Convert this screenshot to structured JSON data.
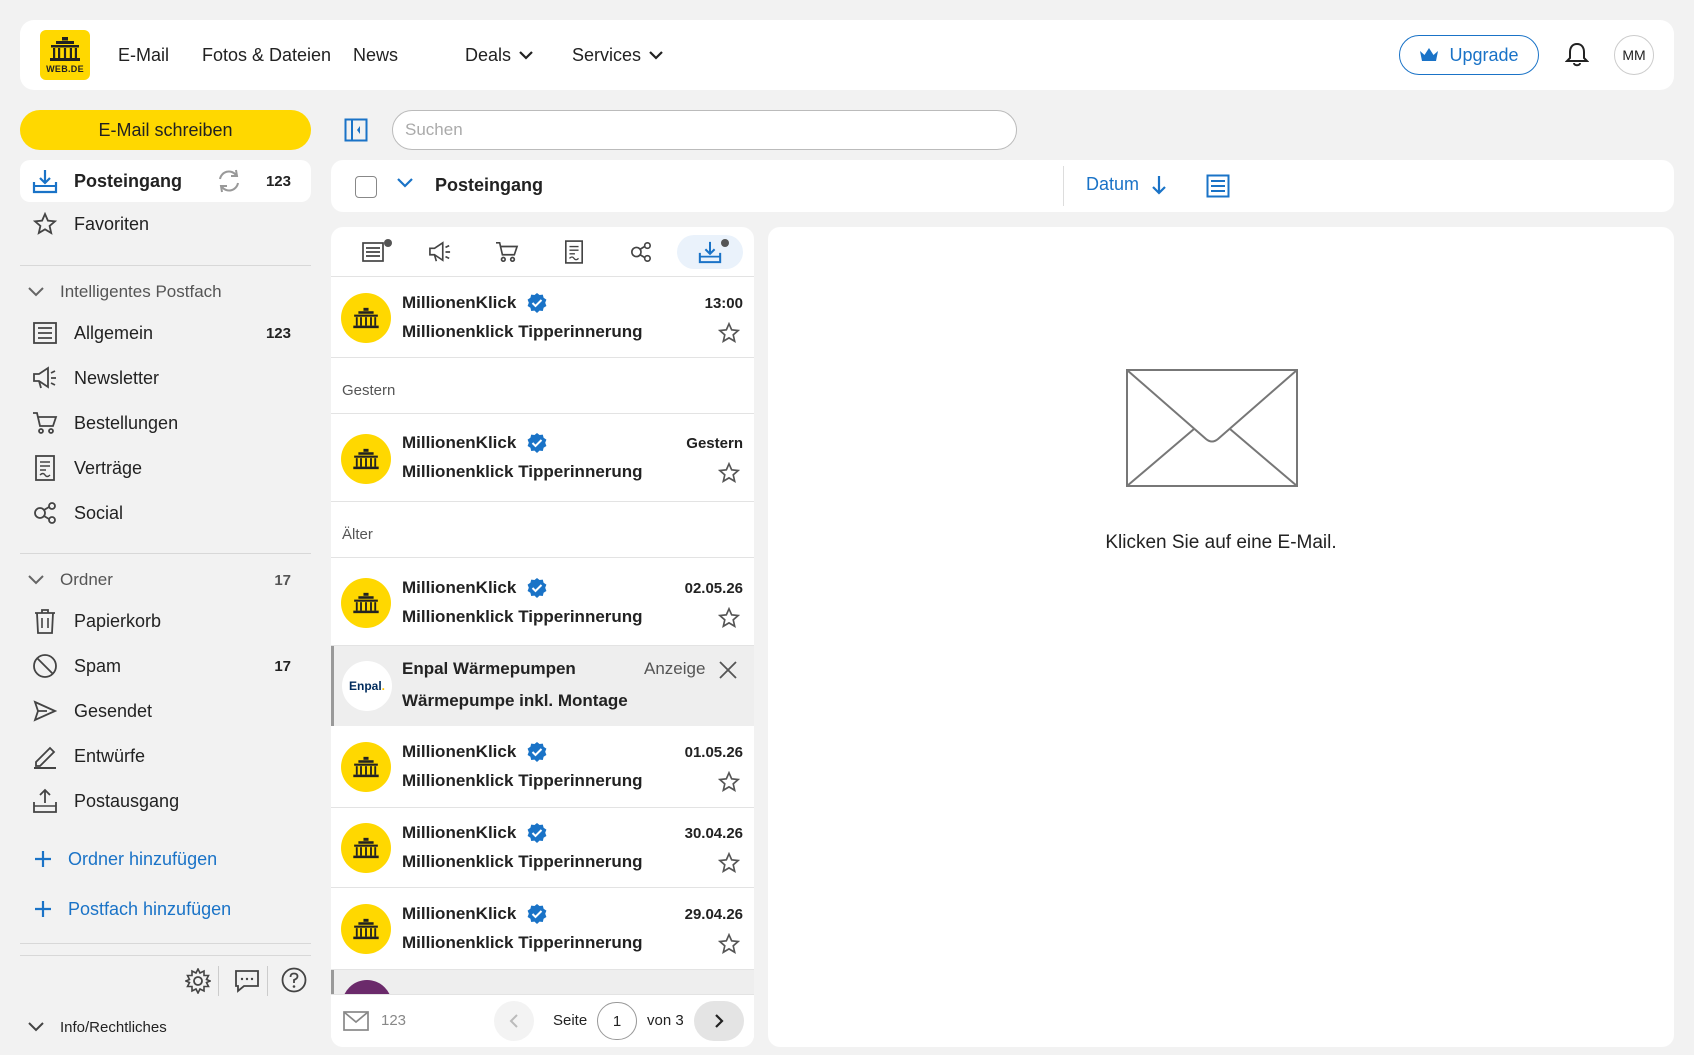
{
  "topnav": {
    "logo_text": "WEB.DE",
    "links": [
      "E-Mail",
      "Fotos & Dateien",
      "News",
      "Deals",
      "Services"
    ],
    "upgrade_label": "Upgrade",
    "avatar_initials": "MM"
  },
  "sidebar": {
    "compose_label": "E-Mail schreiben",
    "inbox": {
      "label": "Posteingang",
      "count": "123"
    },
    "favorites": "Favoriten",
    "smart_section": "Intelligentes Postfach",
    "smart_items": [
      {
        "label": "Allgemein",
        "count": "123"
      },
      {
        "label": "Newsletter",
        "count": ""
      },
      {
        "label": "Bestellungen",
        "count": ""
      },
      {
        "label": "Verträge",
        "count": ""
      },
      {
        "label": "Social",
        "count": ""
      }
    ],
    "folders_section": {
      "label": "Ordner",
      "count": "17"
    },
    "folder_items": [
      {
        "label": "Papierkorb",
        "count": ""
      },
      {
        "label": "Spam",
        "count": "17"
      },
      {
        "label": "Gesendet",
        "count": ""
      },
      {
        "label": "Entwürfe",
        "count": ""
      },
      {
        "label": "Postausgang",
        "count": ""
      }
    ],
    "add_folder": "Ordner hinzufügen",
    "add_mailbox": "Postfach hinzufügen",
    "info_label": "Info/Rechtliches"
  },
  "search": {
    "placeholder": "Suchen"
  },
  "listheader": {
    "title": "Posteingang",
    "sort_label": "Datum"
  },
  "mails": {
    "today": {
      "sender": "MillionenKlick",
      "subject": "Millionenklick Tipperinnerung",
      "date": "13:00"
    },
    "yesterday_label": "Gestern",
    "yesterday": {
      "sender": "MillionenKlick",
      "subject": "Millionenklick Tipperinnerung",
      "date": "Gestern"
    },
    "older_label": "Älter",
    "older": [
      {
        "sender": "MillionenKlick",
        "subject": "Millionenklick Tipperinnerung",
        "date": "02.05.26"
      },
      {
        "sender": "MillionenKlick",
        "subject": "Millionenklick Tipperinnerung",
        "date": "01.05.26"
      },
      {
        "sender": "MillionenKlick",
        "subject": "Millionenklick Tipperinnerung",
        "date": "30.04.26"
      },
      {
        "sender": "MillionenKlick",
        "subject": "Millionenklick Tipperinnerung",
        "date": "29.04.26"
      }
    ],
    "ad": {
      "sender": "Enpal Wärmepumpen",
      "subject": "Wärmepumpe inkl. Montage",
      "tag": "Anzeige",
      "logo_text": "Enpal"
    }
  },
  "pager": {
    "mail_count": "123",
    "page_label": "Seite",
    "page": "1",
    "of_label": "von 3"
  },
  "preview": {
    "hint": "Klicken Sie auf eine E-Mail."
  },
  "colors": {
    "accent": "#1a73c7",
    "brand_yellow": "#ffd800",
    "verified": "#1a73c7"
  }
}
